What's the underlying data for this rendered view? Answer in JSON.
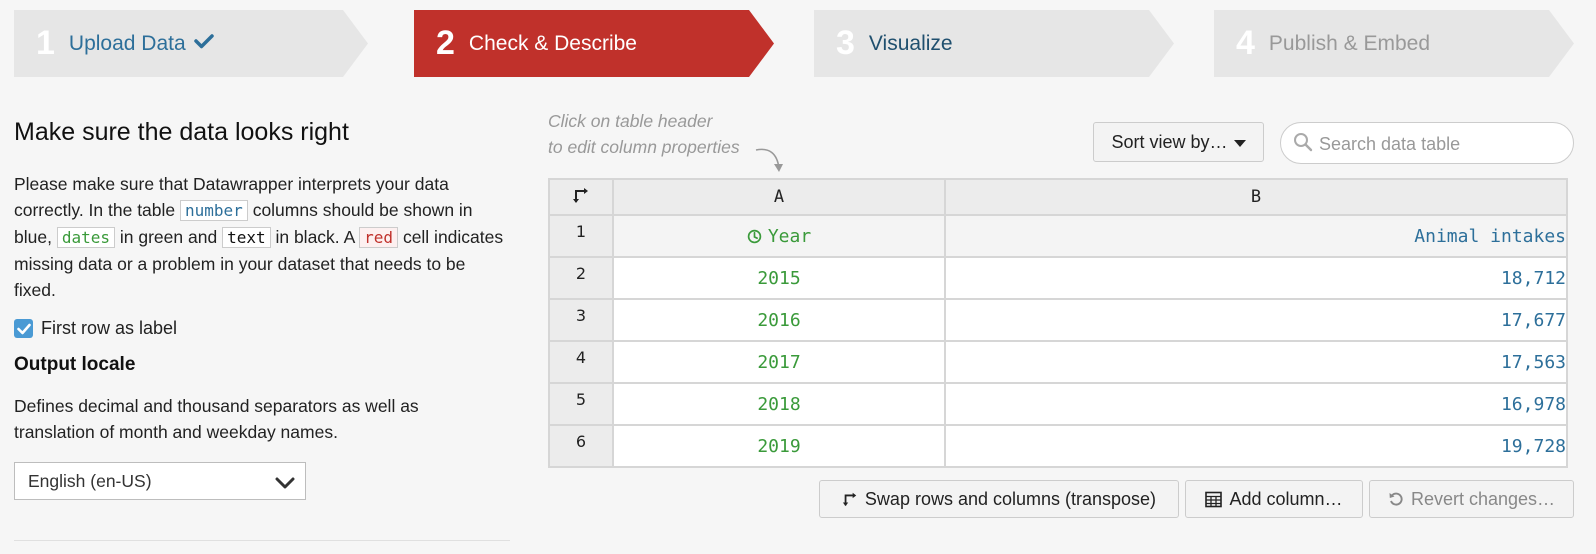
{
  "steps": [
    {
      "num": "1",
      "label": "Upload Data",
      "state": "done"
    },
    {
      "num": "2",
      "label": "Check & Describe",
      "state": "active"
    },
    {
      "num": "3",
      "label": "Visualize",
      "state": "next"
    },
    {
      "num": "4",
      "label": "Publish & Embed",
      "state": "disabled"
    }
  ],
  "left": {
    "title": "Make sure the data looks right",
    "desc": {
      "t1": "Please make sure that Datawrapper interprets your data correctly. In the table",
      "code_number": "number",
      "t2": "columns should be shown in blue,",
      "code_dates": "dates",
      "t3": "in green and",
      "code_text": "text",
      "t4": "in black. A",
      "code_red": "red",
      "t5": "cell indicates missing data or a problem in your dataset that needs to be fixed."
    },
    "first_row_label": "First row as label",
    "first_row_checked": true,
    "output_locale_title": "Output locale",
    "output_locale_desc": "Defines decimal and thousand separators as well as translation of month and weekday names.",
    "locale_value": "English (en-US)"
  },
  "right": {
    "hint_line1": "Click on table header",
    "hint_line2": "to edit column properties",
    "sort_label": "Sort view by…",
    "search_placeholder": "Search data table",
    "table": {
      "col_headers": [
        "A",
        "B"
      ],
      "row_numbers": [
        "1",
        "2",
        "3",
        "4",
        "5",
        "6"
      ],
      "header_row": [
        "Year",
        "Animal intakes"
      ],
      "rows": [
        [
          "2015",
          "18,712"
        ],
        [
          "2016",
          "17,677"
        ],
        [
          "2017",
          "17,563"
        ],
        [
          "2018",
          "16,978"
        ],
        [
          "2019",
          "19,728"
        ]
      ]
    },
    "buttons": {
      "transpose": "Swap rows and columns (transpose)",
      "add_column": "Add column…",
      "revert": "Revert changes…"
    }
  },
  "colors": {
    "accent_red": "#c0312b",
    "number_blue": "#2d6f9a",
    "date_green": "#3a9a3a",
    "step_gray": "#e6e6e6"
  }
}
